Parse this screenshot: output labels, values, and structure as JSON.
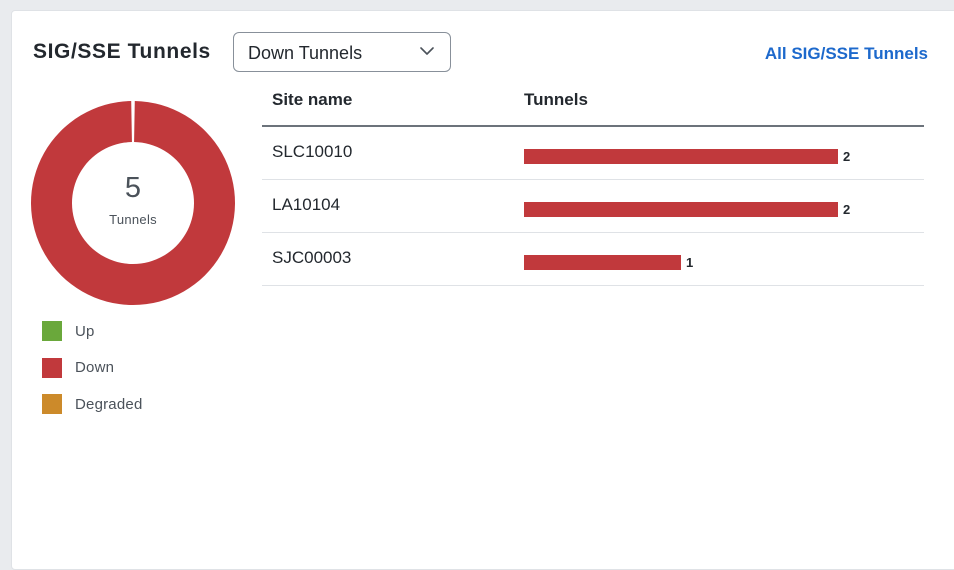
{
  "widget": {
    "title": "SIG/SSE Tunnels",
    "filter": {
      "selected": "Down Tunnels",
      "icon": "chevron-down-icon"
    },
    "all_link": "All SIG/SSE Tunnels"
  },
  "donut": {
    "total": "5",
    "total_label": "Tunnels",
    "segments": [
      {
        "status": "Up",
        "value": 0,
        "color": "#6aa83b"
      },
      {
        "status": "Down",
        "value": 5,
        "color": "#c1393c"
      },
      {
        "status": "Degraded",
        "value": 0,
        "color": "#cc8a2a"
      }
    ]
  },
  "legend": [
    {
      "label": "Up",
      "color": "#6aa83b"
    },
    {
      "label": "Down",
      "color": "#c1393c"
    },
    {
      "label": "Degraded",
      "color": "#cc8a2a"
    }
  ],
  "table": {
    "headers": {
      "site": "Site name",
      "tunnels": "Tunnels"
    },
    "max_value": 2,
    "rows": [
      {
        "site": "SLC10010",
        "tunnels": 2,
        "tunnels_label": "2"
      },
      {
        "site": "LA10104",
        "tunnels": 2,
        "tunnels_label": "2"
      },
      {
        "site": "SJC00003",
        "tunnels": 1,
        "tunnels_label": "1"
      }
    ]
  },
  "colors": {
    "down": "#c1393c",
    "up": "#6aa83b",
    "degraded": "#cc8a2a",
    "link": "#1d69cc"
  }
}
